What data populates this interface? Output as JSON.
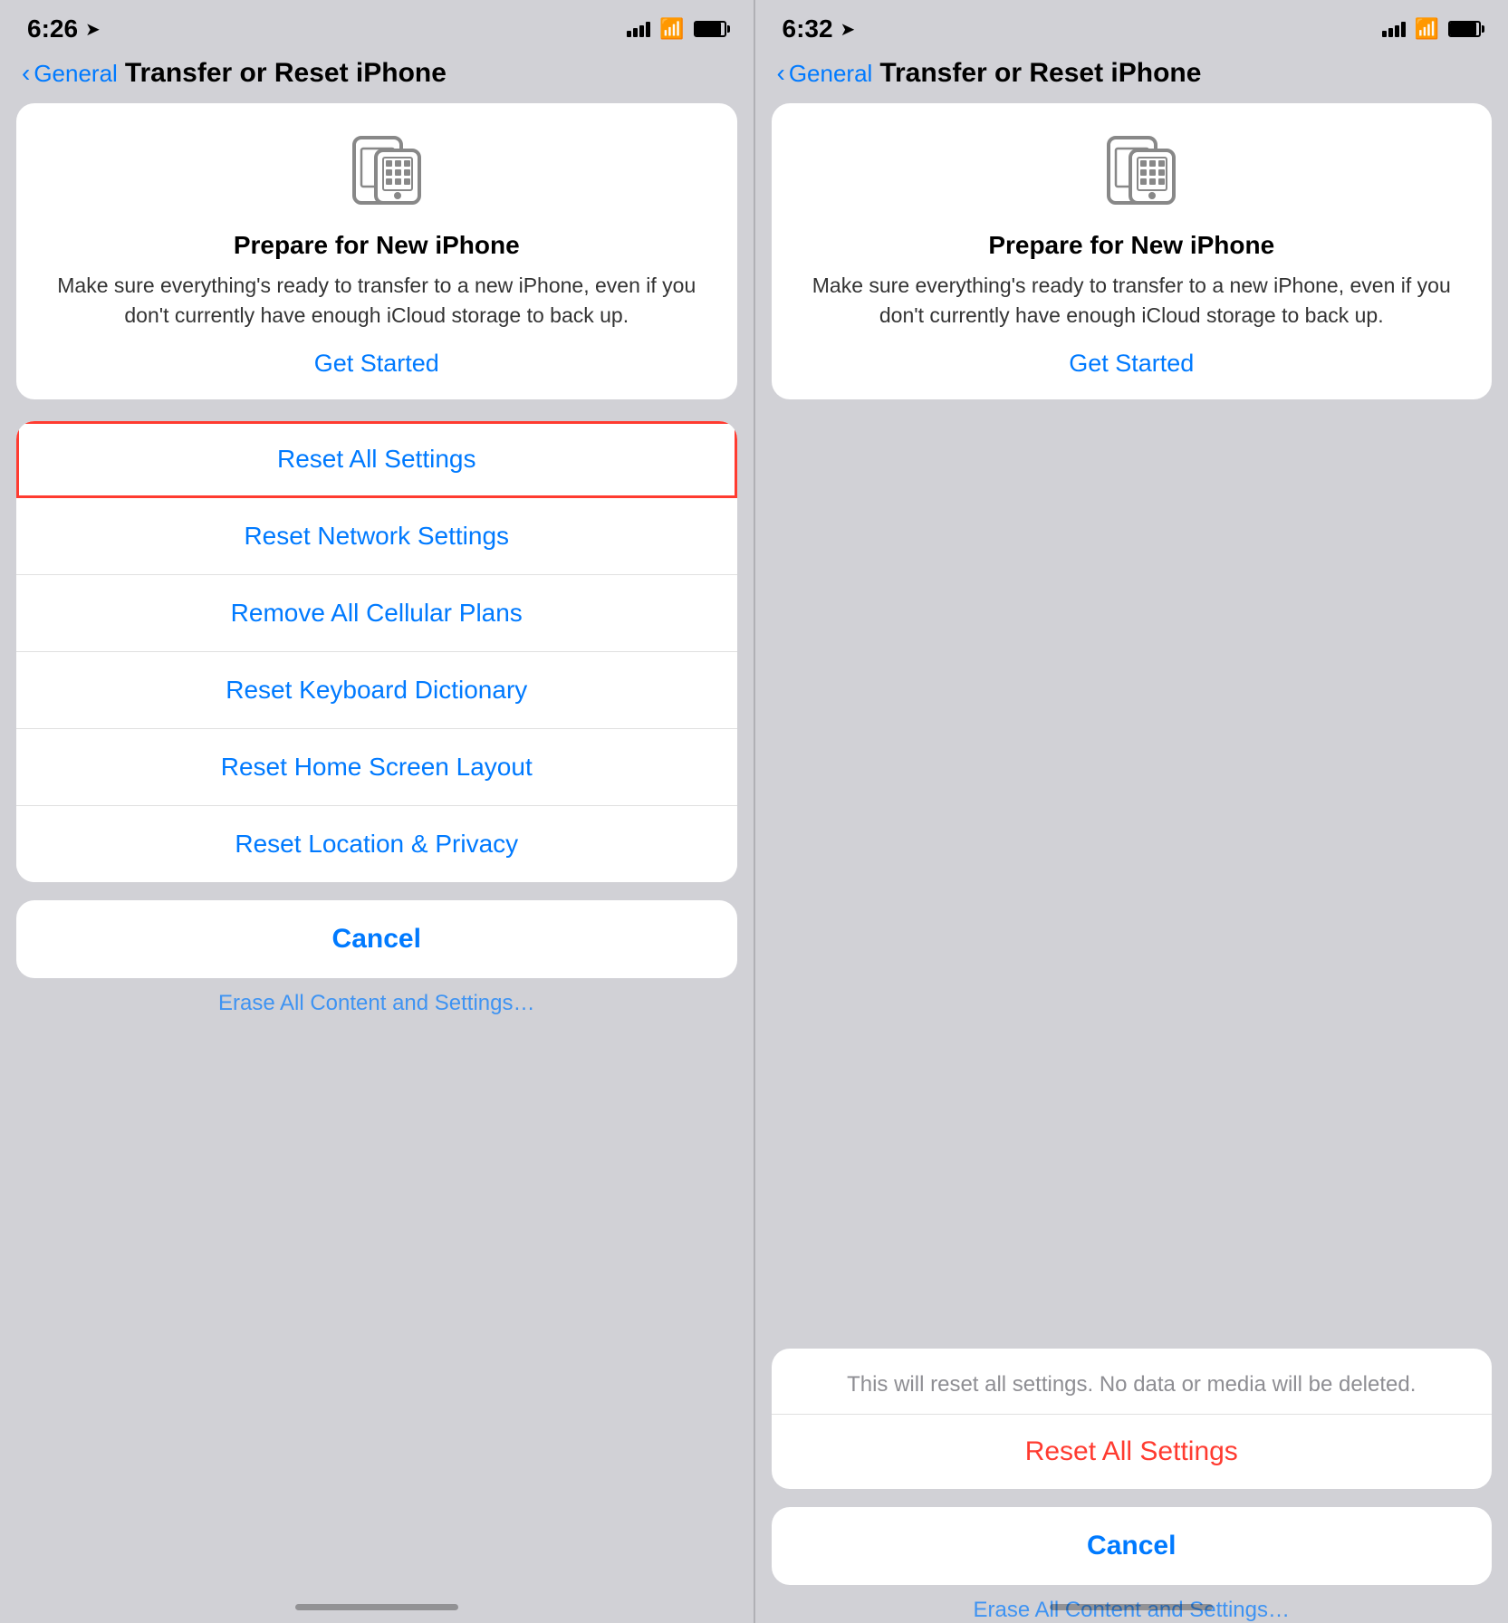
{
  "left_panel": {
    "status": {
      "time": "6:26",
      "location_icon": "▶"
    },
    "nav": {
      "back_label": "General",
      "title": "Transfer or Reset iPhone"
    },
    "prepare_card": {
      "title": "Prepare for New iPhone",
      "description": "Make sure everything's ready to transfer to a new iPhone, even if you don't currently have enough iCloud storage to back up.",
      "get_started": "Get Started"
    },
    "reset_items": [
      {
        "label": "Reset All Settings",
        "highlighted": true
      },
      {
        "label": "Reset Network Settings",
        "highlighted": false
      },
      {
        "label": "Remove All Cellular Plans",
        "highlighted": false
      },
      {
        "label": "Reset Keyboard Dictionary",
        "highlighted": false
      },
      {
        "label": "Reset Home Screen Layout",
        "highlighted": false
      },
      {
        "label": "Reset Location & Privacy",
        "highlighted": false
      }
    ],
    "cancel_label": "Cancel",
    "bottom_hint": "Erase All Content and Settings…"
  },
  "right_panel": {
    "status": {
      "time": "6:32",
      "location_icon": "▶"
    },
    "nav": {
      "back_label": "General",
      "title": "Transfer or Reset iPhone"
    },
    "prepare_card": {
      "title": "Prepare for New iPhone",
      "description": "Make sure everything's ready to transfer to a new iPhone, even if you don't currently have enough iCloud storage to back up.",
      "get_started": "Get Started"
    },
    "confirm_card": {
      "description": "This will reset all settings. No data or media will be deleted.",
      "action_label": "Reset All Settings"
    },
    "cancel_label": "Cancel",
    "bottom_hint": "Erase All Content and Settings…"
  },
  "colors": {
    "blue": "#007aff",
    "red": "#ff3b30",
    "bg": "#d1d1d6",
    "card_bg": "#ffffff",
    "text_primary": "#000000",
    "text_secondary": "#8e8e93"
  }
}
